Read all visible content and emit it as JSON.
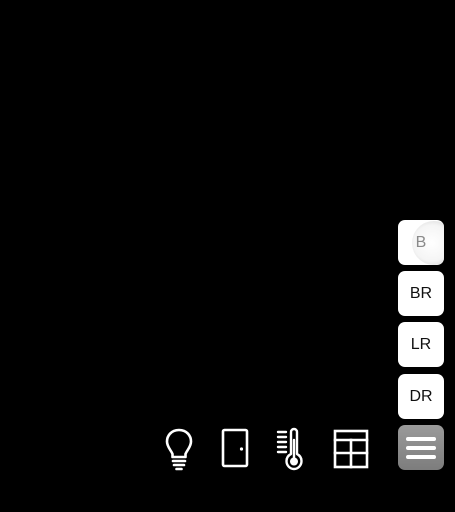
{
  "rooms": [
    {
      "label": "B",
      "active": true
    },
    {
      "label": "BR",
      "active": false
    },
    {
      "label": "LR",
      "active": false
    },
    {
      "label": "DR",
      "active": false
    }
  ],
  "toolbar": {
    "icons": [
      "lightbulb-icon",
      "door-icon",
      "thermometer-icon",
      "window-icon"
    ],
    "menu_icon": "hamburger-menu-icon"
  },
  "colors": {
    "background": "#000000",
    "button": "#ffffff",
    "button_text": "#111111",
    "active_text": "#8a8a8a",
    "menu_button": "#8c8c8c",
    "icon": "#ffffff"
  }
}
